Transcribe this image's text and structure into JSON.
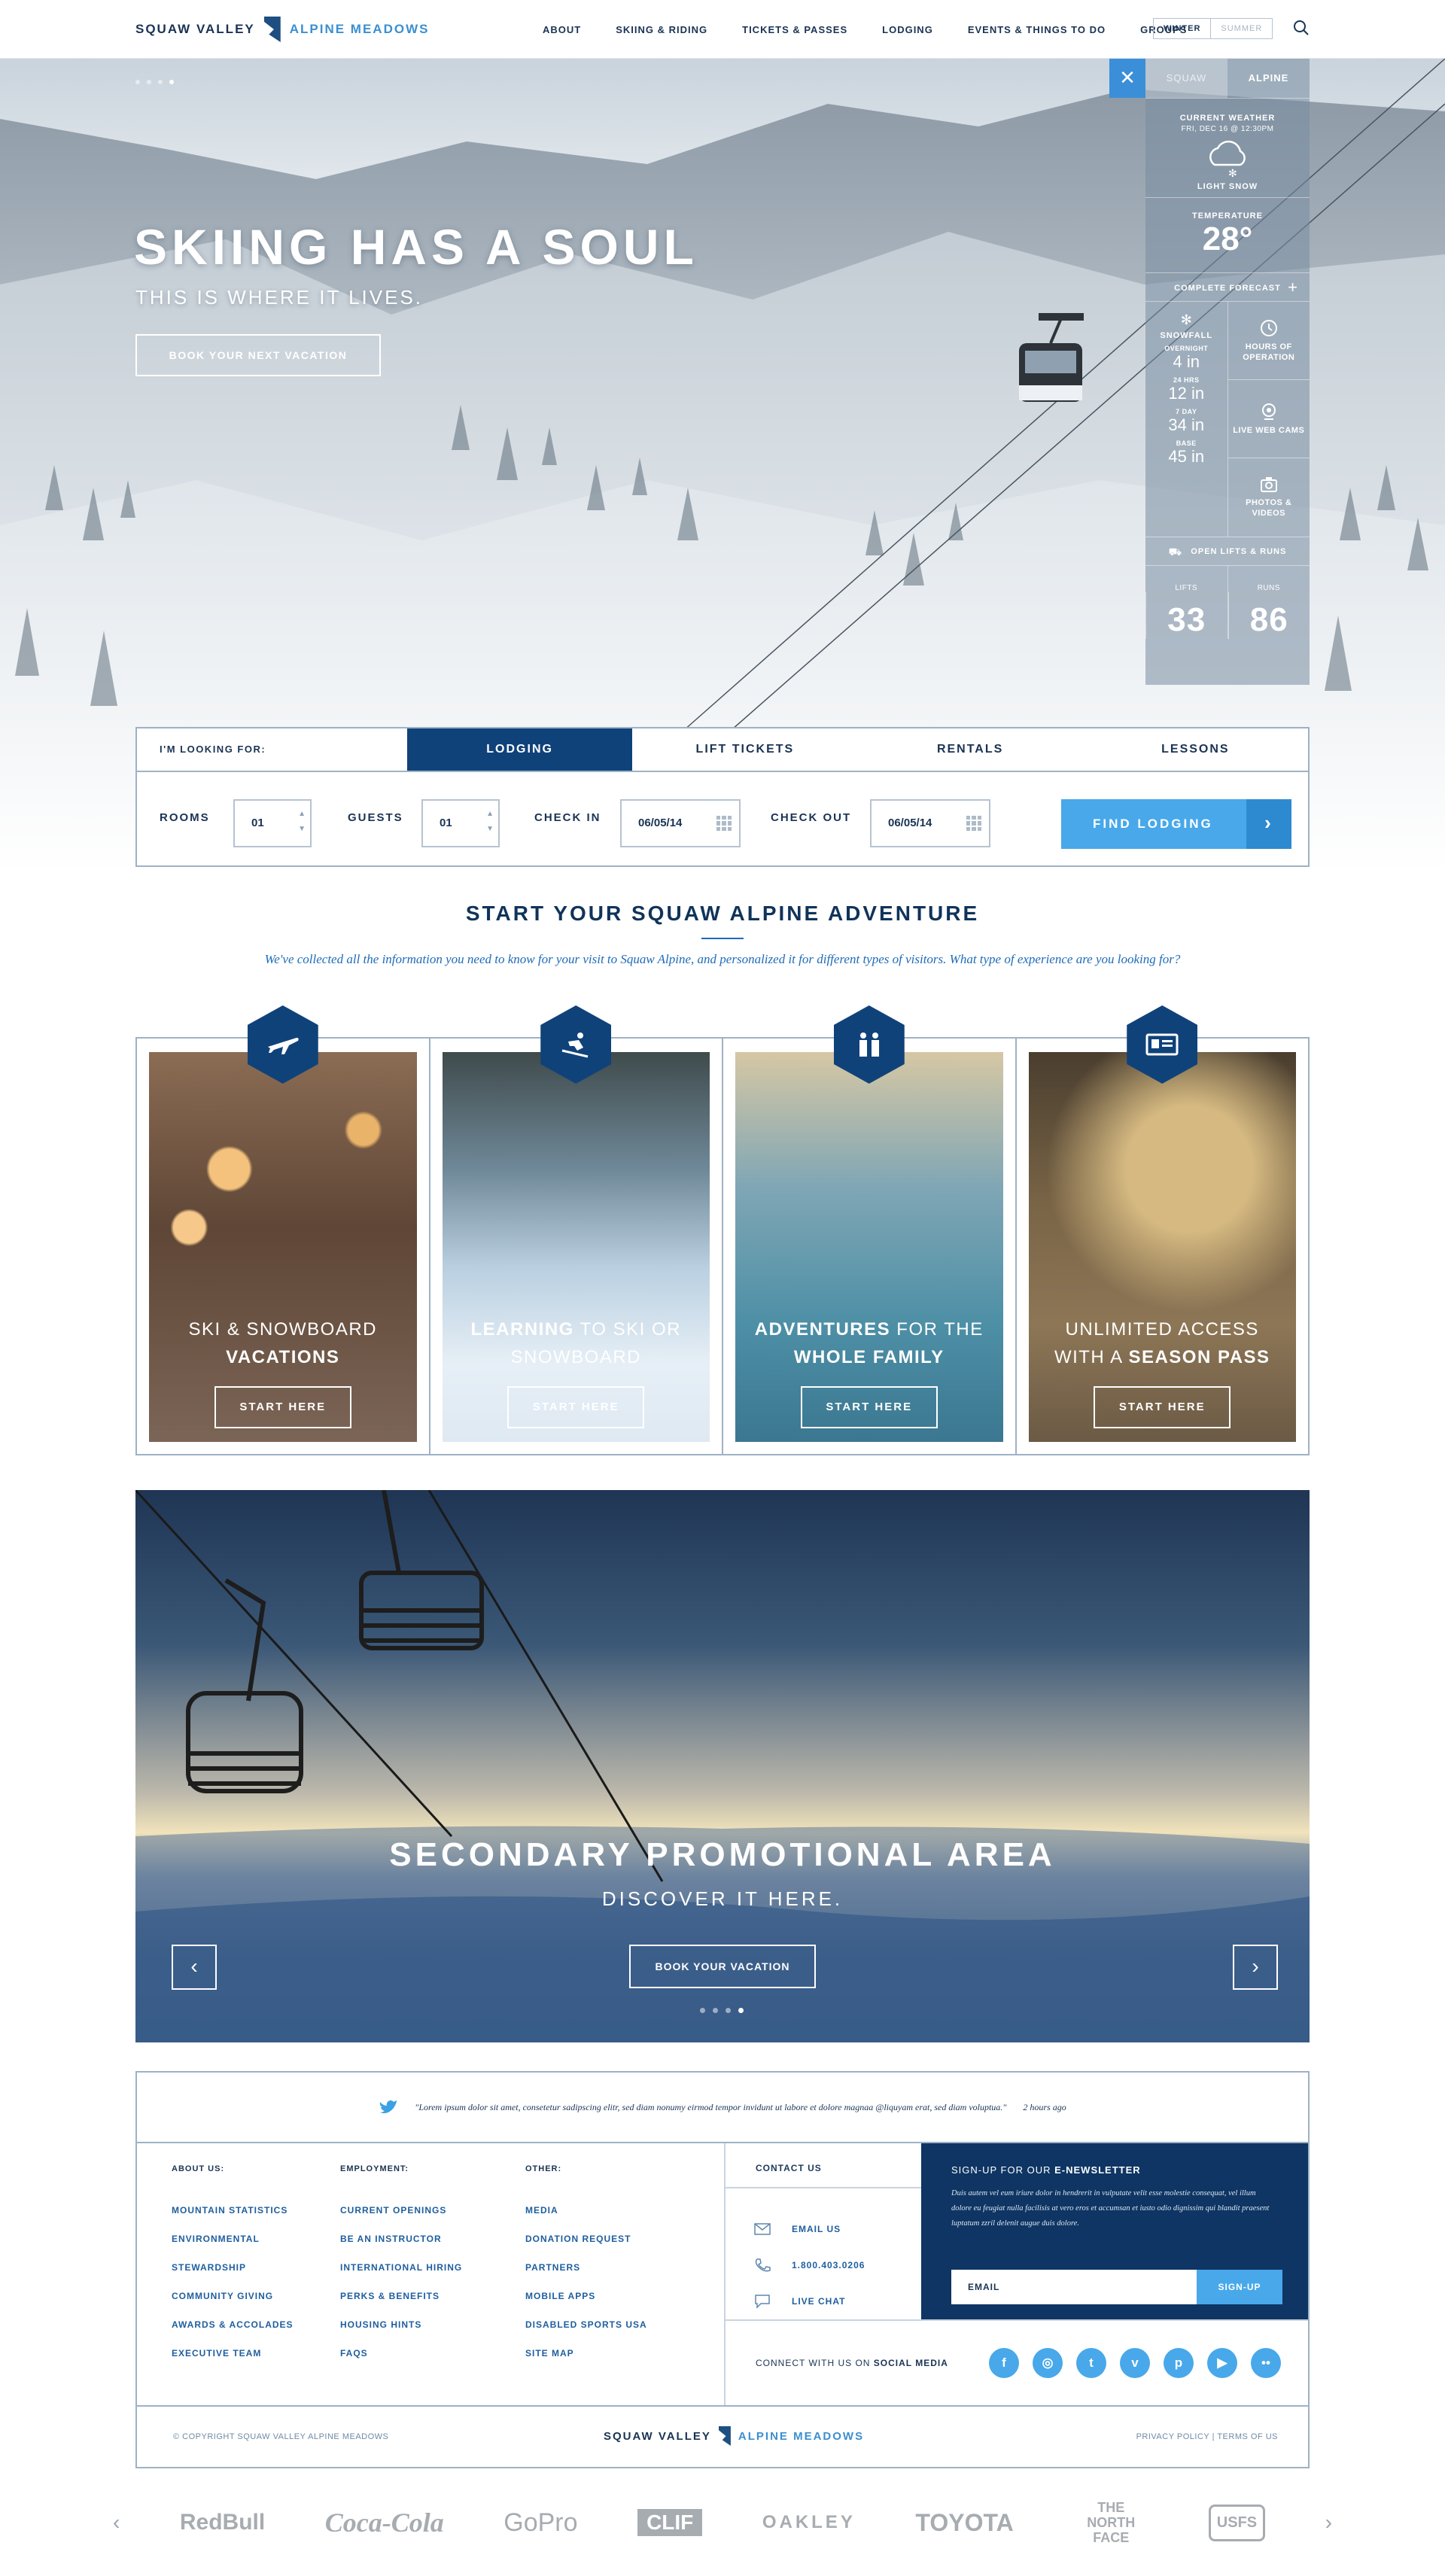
{
  "header": {
    "logo_left": "SQUAW VALLEY",
    "logo_right": "ALPINE MEADOWS",
    "nav": [
      "ABOUT",
      "SKIING & RIDING",
      "TICKETS & PASSES",
      "LODGING",
      "EVENTS & THINGS TO DO",
      "GROUPS"
    ],
    "season_on": "WINTER",
    "season_off": "SUMMER",
    "search_icon": "search-icon"
  },
  "hero": {
    "title": "SKIING HAS A SOUL",
    "subtitle": "THIS IS WHERE IT LIVES.",
    "cta": "BOOK YOUR NEXT VACATION",
    "dots": 4,
    "active_dot": 4
  },
  "weather": {
    "close": "✕",
    "tab_off": "SQUAW",
    "tab_on": "ALPINE",
    "current_label": "CURRENT WEATHER",
    "current_date": "FRI, DEC 16 @ 12:30PM",
    "condition": "LIGHT SNOW",
    "temp_label": "TEMPERATURE",
    "temp": "28°",
    "forecast": "COMPLETE FORECAST",
    "forecast_plus": "+",
    "snowfall_label": "SNOWFALL",
    "snow": [
      {
        "label": "OVERNIGHT",
        "value": "4 in"
      },
      {
        "label": "24 HRS",
        "value": "12 in"
      },
      {
        "label": "7 DAY",
        "value": "34 in"
      },
      {
        "label": "BASE",
        "value": "45 in"
      }
    ],
    "hours": "HOURS OF OPERATION",
    "webcams": "LIVE WEB CAMS",
    "photos": "PHOTOS & VIDEOS",
    "open_label": "OPEN LIFTS & RUNS",
    "lifts_label": "LIFTS",
    "lifts": "33",
    "runs_label": "RUNS",
    "runs": "86"
  },
  "booking": {
    "looking_for": "I'M LOOKING FOR:",
    "tabs": [
      "LODGING",
      "LIFT TICKETS",
      "RENTALS",
      "LESSONS"
    ],
    "rooms_label": "ROOMS",
    "rooms": "01",
    "guests_label": "GUESTS",
    "guests": "01",
    "checkin_label": "CHECK IN",
    "checkin": "06/05/14",
    "checkout_label": "CHECK OUT",
    "checkout": "06/05/14",
    "find": "FIND LODGING",
    "step_up": "▲",
    "step_down": "▼",
    "arrow": "›"
  },
  "adventure": {
    "title": "START YOUR SQUAW ALPINE ADVENTURE",
    "desc": "We've collected all the information you need to know for your visit to Squaw Alpine, and personalized it for different types of visitors. What type of experience are you looking for?",
    "cards": [
      {
        "l1a": "SKI & SNOWBOARD",
        "l1b": "",
        "l2a": "",
        "l2b": "VACATIONS",
        "btn": "START HERE",
        "icon": "airplane-icon"
      },
      {
        "l1a": "",
        "l1b": "LEARNING",
        "l1c": " TO SKI OR",
        "l2a": "SNOWBOARD",
        "l2b": "",
        "btn": "START HERE",
        "icon": "skier-icon"
      },
      {
        "l1a": "",
        "l1b": "ADVENTURES",
        "l1c": " FOR THE",
        "l2a": "",
        "l2b": "WHOLE FAMILY",
        "btn": "START HERE",
        "icon": "family-icon"
      },
      {
        "l1a": "UNLIMITED ACCESS",
        "l1b": "",
        "l2a": "WITH A ",
        "l2b": "SEASON PASS",
        "btn": "START HERE",
        "icon": "pass-icon"
      }
    ]
  },
  "promo": {
    "title": "SECONDARY PROMOTIONAL AREA",
    "subtitle": "DISCOVER IT HERE.",
    "cta": "BOOK YOUR VACATION",
    "prev": "‹",
    "next": "›",
    "dots": 4,
    "active_dot": 4
  },
  "footer": {
    "tweet": "\"Lorem ipsum dolor sit amet, consetetur sadipscing elitr, sed diam nonumy eirmod tempor  invidunt ut labore et dolore magnaa @liquyam erat, sed diam voluptua.\"",
    "tweet_time": "2 hours ago",
    "cols": [
      {
        "title": "ABOUT US:",
        "links": [
          "MOUNTAIN STATISTICS",
          "ENVIRONMENTAL",
          "STEWARDSHIP",
          "COMMUNITY GIVING",
          "AWARDS & ACCOLADES",
          "EXECUTIVE TEAM"
        ]
      },
      {
        "title": "EMPLOYMENT:",
        "links": [
          "CURRENT OPENINGS",
          "BE AN INSTRUCTOR",
          "INTERNATIONAL HIRING",
          "PERKS & BENEFITS",
          "HOUSING HINTS",
          "FAQS"
        ]
      },
      {
        "title": "OTHER:",
        "links": [
          "MEDIA",
          "DONATION REQUEST",
          "PARTNERS",
          "MOBILE APPS",
          "DISABLED SPORTS USA",
          "SITE MAP"
        ]
      }
    ],
    "contact_title": "CONTACT US",
    "email_us": "EMAIL US",
    "phone": "1.800.403.0206",
    "live_chat": "LIVE CHAT",
    "news_title_a": "SIGN-UP FOR OUR ",
    "news_title_b": "E-NEWSLETTER",
    "news_text": "Duis autem vel eum iriure dolor in hendrerit in vulputate velit esse molestie consequat, vel illum dolore eu feugiat nulla facilisis at vero eros et accumsan et iusto odio dignissim qui blandit praesent luptatum zzril delenit augue duis dolore.",
    "email_placeholder": "EMAIL",
    "signup": "SIGN-UP",
    "connect_a": "CONNECT WITH US ON ",
    "connect_b": "SOCIAL MEDIA",
    "social": [
      {
        "name": "facebook-icon",
        "glyph": "f"
      },
      {
        "name": "instagram-icon",
        "glyph": "◎"
      },
      {
        "name": "twitter-icon",
        "glyph": "t"
      },
      {
        "name": "vimeo-icon",
        "glyph": "v"
      },
      {
        "name": "pinterest-icon",
        "glyph": "p"
      },
      {
        "name": "youtube-icon",
        "glyph": "▶"
      },
      {
        "name": "flickr-icon",
        "glyph": "••"
      }
    ],
    "copyright": "© COPYRIGHT SQUAW VALLEY ALPINE MEADOWS",
    "legal": "PRIVACY POLICY  |  TERMS OF US"
  },
  "sponsors": {
    "prev": "‹",
    "next": "›",
    "items": [
      "RedBull",
      "Coca-Cola",
      "GoPro",
      "CLIF",
      "OAKLEY",
      "TOYOTA",
      "THE NORTH FACE",
      "USFS"
    ]
  },
  "colors": {
    "navy": "#10427a",
    "blue": "#48a8ea",
    "text": "#1a3353"
  }
}
